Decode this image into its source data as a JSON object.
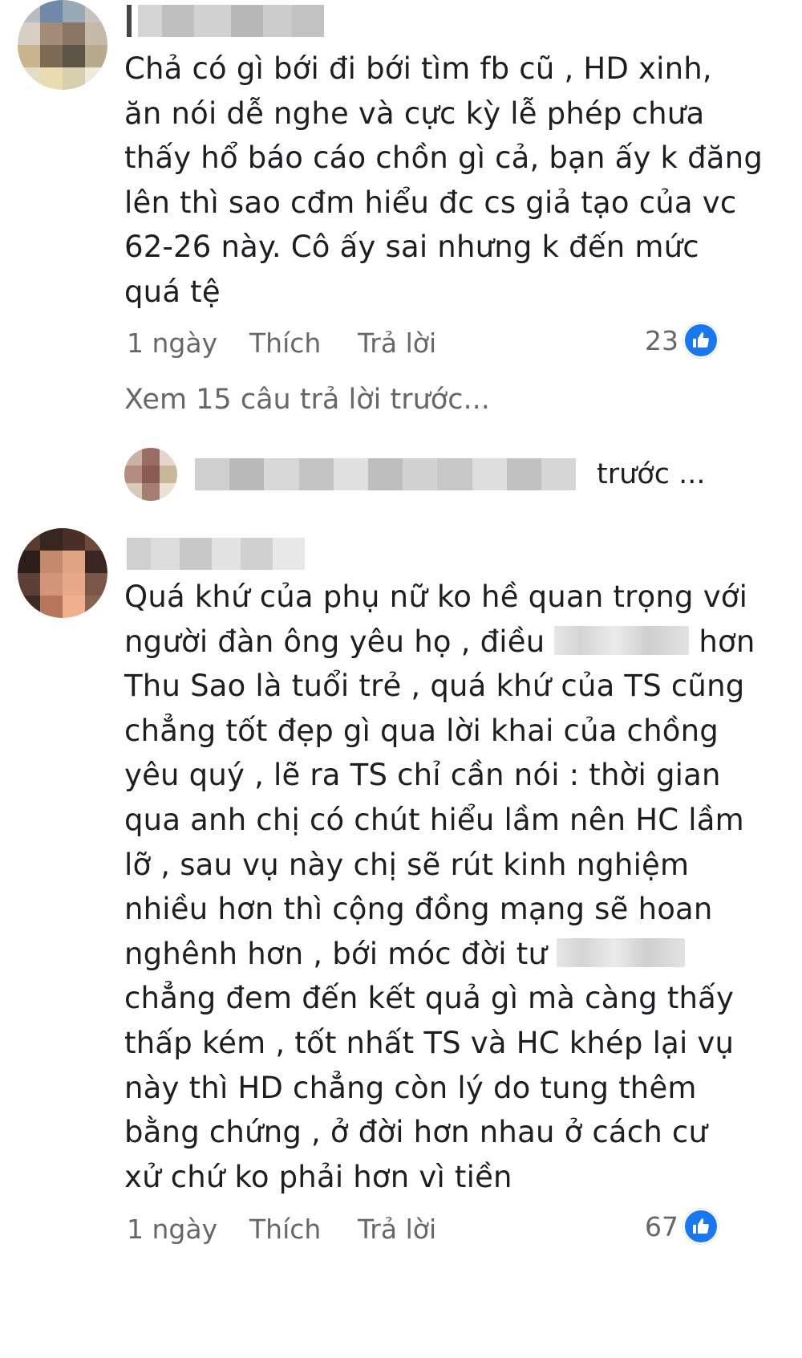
{
  "comments": [
    {
      "author": "",
      "text_lines": [
        "Chả có gì bới đi bới tìm fb cũ , HD xinh,",
        "ăn nói dễ nghe và cực kỳ lễ phép chưa",
        "thấy hổ báo cáo chồn gì cả, bạn ấy k đăng",
        "lên thì sao cđm hiểu đc cs giả tạo của vc",
        "62-26 này. Cô ấy sai nhưng k đến mức",
        "quá tệ"
      ],
      "time": "1 ngày",
      "like_label": "Thích",
      "reply_label": "Trả lời",
      "reaction_count": "23"
    },
    {
      "author": "",
      "text_lines": [
        "Quá khứ của phụ nữ ko hề quan trọng với",
        "người đàn ông yêu họ , điều",
        "Thu Sao là tuổi trẻ , quá khứ của TS cũng",
        "chẳng tốt đẹp gì qua lời khai của chồng",
        "yêu quý , lẽ ra TS chỉ cần nói : thời gian",
        "qua anh chị có chút hiểu lầm nên HC lầm",
        "lỡ , sau vụ này chị sẽ rút kinh nghiệm",
        "nhiều hơn thì cộng đồng mạng sẽ hoan",
        "nghênh hơn , bới móc đời tư",
        "chẳng đem đến kết quả gì mà càng thấy",
        "thấp kém , tốt nhất TS và HC khép lại vụ",
        "này thì HD chẳng còn lý do tung thêm",
        "bằng chứng , ở đời hơn nhau ở cách cư",
        "xử chứ ko phải hơn vì tiền"
      ],
      "line2_suffix": "hơn",
      "time": "1 ngày",
      "like_label": "Thích",
      "reply_label": "Trả lời",
      "reaction_count": "67"
    }
  ],
  "view_previous_replies": "Xem 15 câu trả lời trước...",
  "reply_preview_suffix": "trước ...",
  "colors": {
    "text": "#1c1e21",
    "secondary": "#65676b",
    "like_blue": "#1877f2"
  },
  "icons": {
    "reaction": "thumbs-up-icon"
  }
}
